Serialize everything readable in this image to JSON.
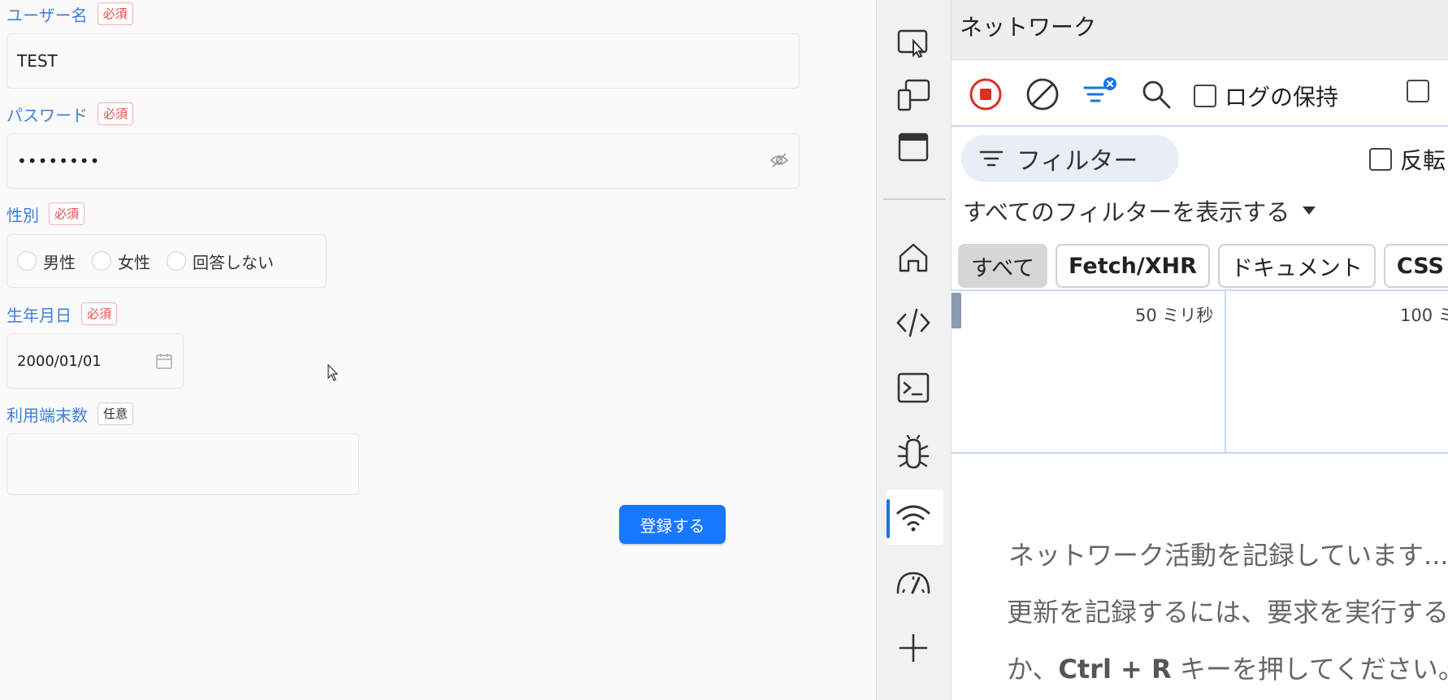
{
  "form": {
    "username": {
      "label": "ユーザー名",
      "badge": "必須",
      "value": "TEST"
    },
    "password": {
      "label": "パスワード",
      "badge": "必須",
      "value": "••••••••"
    },
    "gender": {
      "label": "性別",
      "badge": "必須",
      "options": [
        "男性",
        "女性",
        "回答しない"
      ]
    },
    "birthdate": {
      "label": "生年月日",
      "badge": "必須",
      "value": "2000/01/01"
    },
    "devices": {
      "label": "利用端末数",
      "badge": "任意",
      "value": ""
    },
    "submit_label": "登録する"
  },
  "devtools": {
    "panel_title": "ネットワーク",
    "toolbar": {
      "preserve_log_label": "ログの保持"
    },
    "filter": {
      "placeholder": "フィルター",
      "invert_label": "反転",
      "show_all_label": "すべてのフィルターを表示する"
    },
    "chips": [
      "すべて",
      "Fetch/XHR",
      "ドキュメント",
      "CSS"
    ],
    "timeline": {
      "tick1": "50 ミリ秒",
      "tick2": "100 ミリ秒"
    },
    "empty_message": {
      "line1": "ネットワーク活動を記録しています...",
      "line2": "更新を記録するには、要求を実行する",
      "line3_pre": "か、",
      "line3_key": "Ctrl + R",
      "line3_post": " キーを押してください。"
    },
    "colors": {
      "accent": "#1a73e8",
      "record": "#d93025"
    }
  }
}
